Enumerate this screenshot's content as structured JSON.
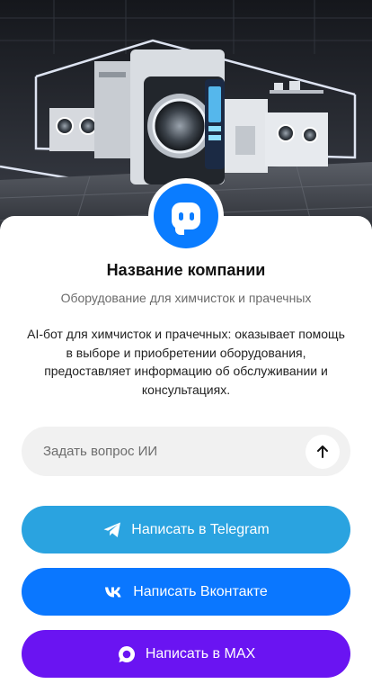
{
  "hero": {
    "image_description_icon": "laundry-equipment-showroom-image"
  },
  "profile": {
    "avatar_icon": "chat-bot-icon",
    "company_name": "Название компании",
    "subtitle": "Оборудование для химчисток и прачечных",
    "description": "AI-бот для химчисток и прачечных: оказывает помощь в выборе и приобретении оборудования, предоставляет информацию об обслуживании и консультациях."
  },
  "ask": {
    "placeholder": "Задать вопрос ИИ",
    "send_icon": "arrow-up-icon"
  },
  "buttons": {
    "telegram": {
      "label": "Написать в Telegram",
      "icon": "telegram-icon",
      "color": "#2aa3e0"
    },
    "vk": {
      "label": "Написать Вконтакте",
      "icon": "vk-icon",
      "color": "#0a77ff"
    },
    "max": {
      "label": "Написать в MAX",
      "icon": "max-icon",
      "color": "#6a14f2"
    }
  },
  "colors": {
    "accent": "#0a7cff",
    "input_bg": "#f1f1f1"
  }
}
